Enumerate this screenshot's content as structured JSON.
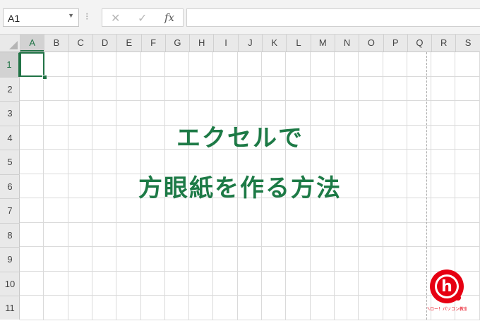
{
  "formula_bar": {
    "name_box_value": "A1",
    "cancel_glyph": "✕",
    "enter_glyph": "✓",
    "fx_label": "fx",
    "formula_value": ""
  },
  "columns": [
    "A",
    "B",
    "C",
    "D",
    "E",
    "F",
    "G",
    "H",
    "I",
    "J",
    "K",
    "L",
    "M",
    "N",
    "O",
    "P",
    "Q",
    "R",
    "S"
  ],
  "rows": [
    "1",
    "2",
    "3",
    "4",
    "5",
    "6",
    "7",
    "8",
    "9",
    "10",
    "11"
  ],
  "active_cell": "A1",
  "title": {
    "line1": "エクセルで",
    "line2": "方眼紙を作る方法"
  },
  "logo": {
    "letter": "h",
    "caption": "ハロー！パソコン教室"
  },
  "colors": {
    "accent_green": "#217346",
    "title_green": "#1d7a46",
    "logo_red": "#e60012"
  }
}
